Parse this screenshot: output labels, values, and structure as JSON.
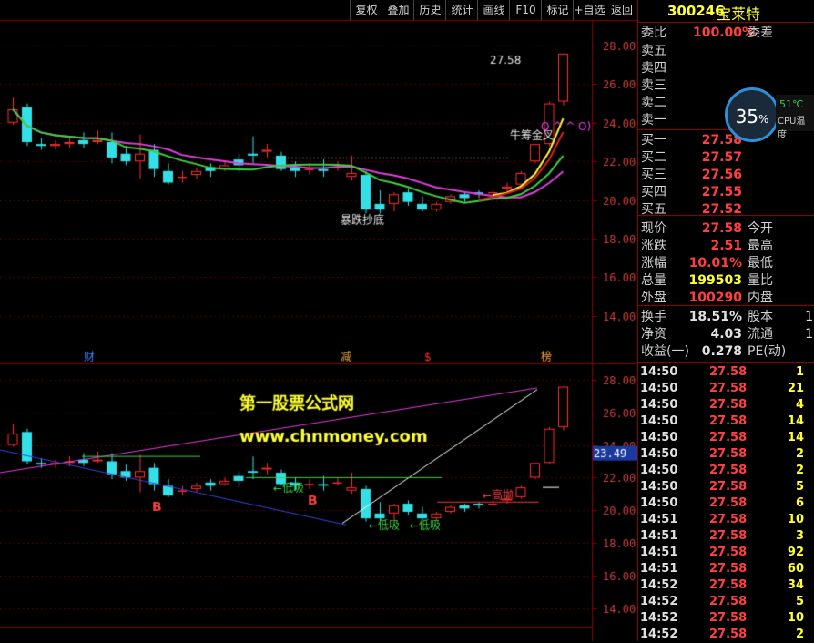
{
  "toolbar": [
    "复权",
    "叠加",
    "历史",
    "统计",
    "画线",
    "F10",
    "标记",
    "+自选",
    "返回"
  ],
  "stock": {
    "code": "300246",
    "name": "宝莱特"
  },
  "order_ratio": {
    "label": "委比",
    "value": "100.00%",
    "label2": "委差"
  },
  "asks": [
    {
      "label": "卖五",
      "price": ""
    },
    {
      "label": "卖四",
      "price": ""
    },
    {
      "label": "卖三",
      "price": ""
    },
    {
      "label": "卖二",
      "price": ""
    },
    {
      "label": "卖一",
      "price": ""
    }
  ],
  "bids": [
    {
      "label": "买一",
      "price": "27.58"
    },
    {
      "label": "买二",
      "price": "27.57"
    },
    {
      "label": "买三",
      "price": "27.56"
    },
    {
      "label": "买四",
      "price": "27.55"
    },
    {
      "label": "买五",
      "price": "27.52"
    }
  ],
  "quote": [
    {
      "l1": "现价",
      "v": "27.58",
      "l2": "今开",
      "color": "#ff4040"
    },
    {
      "l1": "涨跌",
      "v": "2.51",
      "l2": "最高",
      "color": "#ff4040"
    },
    {
      "l1": "涨幅",
      "v": "10.01%",
      "l2": "最低",
      "color": "#ff4040"
    },
    {
      "l1": "总量",
      "v": "199503",
      "l2": "量比",
      "color": "#ffff33"
    },
    {
      "l1": "外盘",
      "v": "100290",
      "l2": "内盘",
      "color": "#ff4040"
    }
  ],
  "fundamentals": [
    {
      "l1": "换手",
      "v": "18.51%",
      "l2": "股本",
      "r": "1"
    },
    {
      "l1": "净资",
      "v": "4.03",
      "l2": "流通",
      "r": "1"
    },
    {
      "l1": "收益(一)",
      "v": "0.278",
      "l2": "PE(动)",
      "r": ""
    }
  ],
  "cpu": {
    "percent": "35",
    "unit": "%",
    "temp": "51℃",
    "label": "CPU温度"
  },
  "ticks": [
    [
      "14:50",
      "27.58",
      "1"
    ],
    [
      "14:50",
      "27.58",
      "21"
    ],
    [
      "14:50",
      "27.58",
      "4"
    ],
    [
      "14:50",
      "27.58",
      "14"
    ],
    [
      "14:50",
      "27.58",
      "14"
    ],
    [
      "14:50",
      "27.58",
      "2"
    ],
    [
      "14:50",
      "27.58",
      "2"
    ],
    [
      "14:50",
      "27.58",
      "5"
    ],
    [
      "14:50",
      "27.58",
      "6"
    ],
    [
      "14:51",
      "27.58",
      "10"
    ],
    [
      "14:51",
      "27.58",
      "3"
    ],
    [
      "14:51",
      "27.58",
      "92"
    ],
    [
      "14:51",
      "27.58",
      "60"
    ],
    [
      "14:52",
      "27.58",
      "34"
    ],
    [
      "14:52",
      "27.58",
      "5"
    ],
    [
      "14:52",
      "27.58",
      "10"
    ],
    [
      "14:52",
      "27.58",
      "2"
    ]
  ],
  "main_chart": {
    "price_axis": [
      "28.00",
      "26.00",
      "24.00",
      "22.00",
      "20.00",
      "18.00",
      "16.00",
      "14.00"
    ],
    "annotations": {
      "high_label": "27.58",
      "bull_label": "牛筹金叉",
      "crash_label": "暴跌抄底",
      "ma_tail": "Q ^ ^ O)"
    },
    "event_markers": [
      "财",
      "减",
      "$",
      "榜"
    ]
  },
  "sub_chart": {
    "price_axis": [
      "28.00",
      "26.00",
      "24.00",
      "22.00",
      "20.00",
      "18.00",
      "16.00",
      "14.00"
    ],
    "current_price_tag": "23.49",
    "watermark_title": "第一股票公式网",
    "watermark_url": "www.chnmoney.com",
    "labels": {
      "low_buy": "低吸",
      "high_sell": "高抛",
      "buy": "B"
    }
  },
  "chart_data": {
    "type": "candlestick",
    "candles": [
      [
        24.0,
        24.7,
        25.3,
        23.9,
        1
      ],
      [
        24.8,
        23.0,
        25.0,
        22.8,
        1
      ],
      [
        22.9,
        22.8,
        23.2,
        22.6,
        0
      ],
      [
        22.8,
        22.9,
        23.1,
        22.6,
        0
      ],
      [
        22.9,
        23.0,
        23.3,
        22.7,
        0
      ],
      [
        23.1,
        22.9,
        23.5,
        22.7,
        0
      ],
      [
        23.0,
        23.1,
        23.6,
        22.9,
        0
      ],
      [
        23.0,
        22.2,
        23.5,
        21.9,
        0
      ],
      [
        22.4,
        22.0,
        22.8,
        21.8,
        0
      ],
      [
        22.0,
        22.4,
        23.4,
        21.1,
        0
      ],
      [
        22.6,
        21.6,
        22.9,
        21.2,
        0
      ],
      [
        21.5,
        20.9,
        21.9,
        20.8,
        0
      ],
      [
        21.2,
        21.2,
        21.5,
        20.9,
        0
      ],
      [
        21.3,
        21.5,
        21.7,
        21.1,
        0
      ],
      [
        21.7,
        21.5,
        21.9,
        21.2,
        0
      ],
      [
        21.6,
        21.8,
        22.0,
        21.5,
        0
      ],
      [
        22.1,
        21.8,
        22.4,
        21.4,
        0
      ],
      [
        22.4,
        22.3,
        23.3,
        21.9,
        0
      ],
      [
        22.5,
        22.6,
        22.9,
        22.2,
        0
      ],
      [
        22.3,
        21.6,
        22.5,
        21.5,
        0
      ],
      [
        21.7,
        21.5,
        22.0,
        21.2,
        0
      ],
      [
        21.6,
        21.6,
        21.9,
        21.3,
        0
      ],
      [
        21.6,
        21.5,
        22.1,
        21.2,
        0
      ],
      [
        21.7,
        21.7,
        22.0,
        21.5,
        0
      ],
      [
        21.2,
        21.4,
        22.3,
        21.0,
        0
      ],
      [
        21.3,
        19.5,
        21.5,
        19.3,
        0
      ],
      [
        19.8,
        19.5,
        20.5,
        19.3,
        0
      ],
      [
        19.8,
        20.3,
        20.4,
        19.4,
        0
      ],
      [
        20.4,
        19.9,
        20.6,
        19.7,
        0
      ],
      [
        19.8,
        19.5,
        20.2,
        19.4,
        0
      ],
      [
        19.5,
        19.8,
        19.9,
        19.4,
        0
      ],
      [
        19.9,
        20.2,
        20.3,
        19.8,
        0
      ],
      [
        20.3,
        20.1,
        20.4,
        19.9,
        0
      ],
      [
        20.4,
        20.3,
        20.5,
        20.1,
        0
      ],
      [
        20.4,
        20.4,
        20.6,
        20.3,
        0
      ],
      [
        20.6,
        20.7,
        20.9,
        20.4,
        0
      ],
      [
        20.8,
        21.4,
        21.5,
        20.7,
        0
      ],
      [
        22.0,
        22.9,
        22.9,
        21.9,
        1
      ],
      [
        22.9,
        25.0,
        25.1,
        22.8,
        1
      ],
      [
        25.1,
        27.58,
        27.58,
        24.9,
        1
      ]
    ]
  }
}
